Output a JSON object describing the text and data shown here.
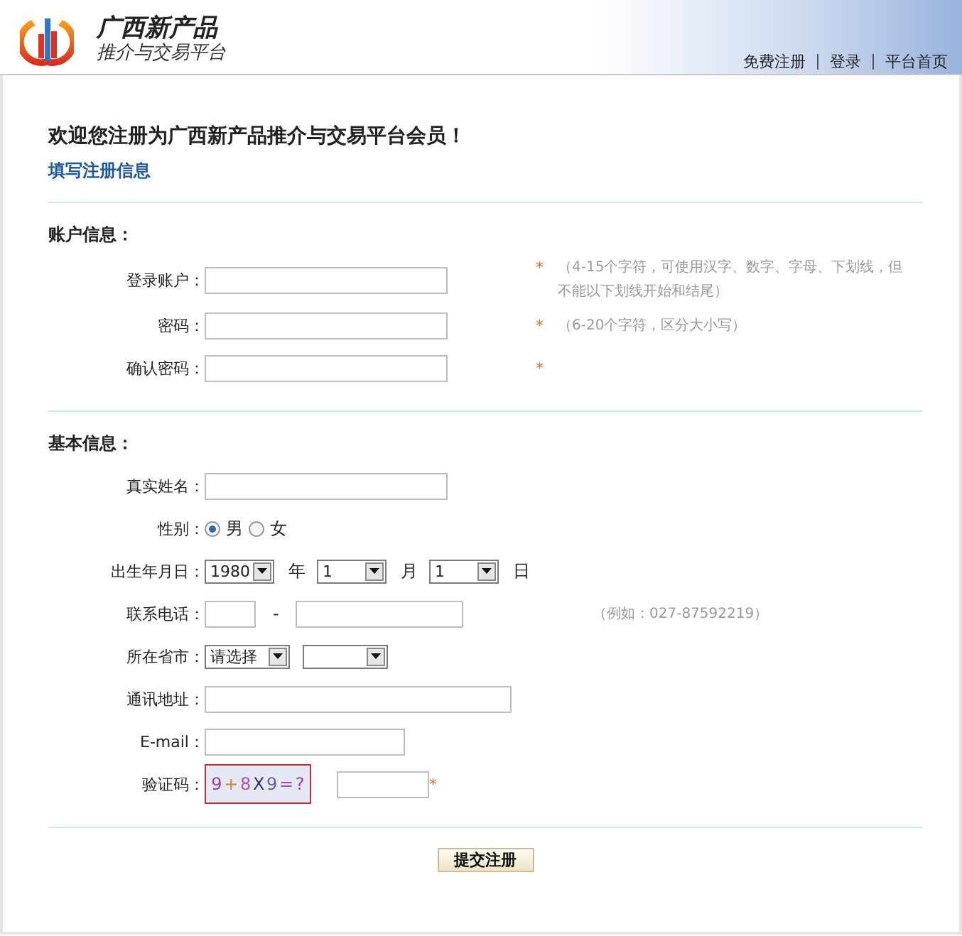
{
  "header": {
    "title": "广西新产品",
    "subtitle": "推介与交易平台",
    "nav": [
      {
        "label": "免费注册"
      },
      {
        "label": "登录"
      },
      {
        "label": "平台首页"
      }
    ]
  },
  "heading": "欢迎您注册为广西新产品推介与交易平台会员！",
  "subheading": "填写注册信息",
  "sections": [
    {
      "title": "账户信息：",
      "rows": [
        {
          "kind": "text",
          "label": "登录账户：",
          "mark": "*",
          "hint": "（4-15个字符，可使用汉字、数字、字母、下划线，但不能以下划线开始和结尾）"
        },
        {
          "kind": "text",
          "label": "密码：",
          "mark": "*",
          "hint": "（6-20个字符，区分大小写）"
        },
        {
          "kind": "text",
          "label": "确认密码：",
          "mark": "*"
        }
      ]
    },
    {
      "title": "基本信息：",
      "rows": [
        {
          "kind": "text",
          "label": "真实姓名："
        },
        {
          "kind": "radio",
          "label": "性别：",
          "options": [
            {
              "label": "男",
              "selected": true
            },
            {
              "label": "女",
              "selected": false
            }
          ]
        },
        {
          "kind": "date",
          "label": "出生年月日：",
          "parts": [
            {
              "value": "1980",
              "unit": "年"
            },
            {
              "value": "1",
              "unit": "月"
            },
            {
              "value": "1",
              "unit": "日"
            }
          ]
        },
        {
          "kind": "phone",
          "label": "联系电话：",
          "separator": "-",
          "hint": "（例如：027-87592219）"
        },
        {
          "kind": "region",
          "label": "所在省市：",
          "selects": [
            {
              "kind": "choice",
              "value": "请选择"
            },
            {
              "kind": "blank"
            }
          ]
        },
        {
          "kind": "long",
          "label": "通讯地址："
        },
        {
          "kind": "medium",
          "label": "E-mail："
        },
        {
          "kind": "captcha",
          "label": "验证码：",
          "captcha": [
            "9",
            "+",
            "8",
            "X",
            "9",
            "=",
            "?"
          ],
          "mark": "*"
        }
      ]
    }
  ],
  "submit": "提交注册"
}
